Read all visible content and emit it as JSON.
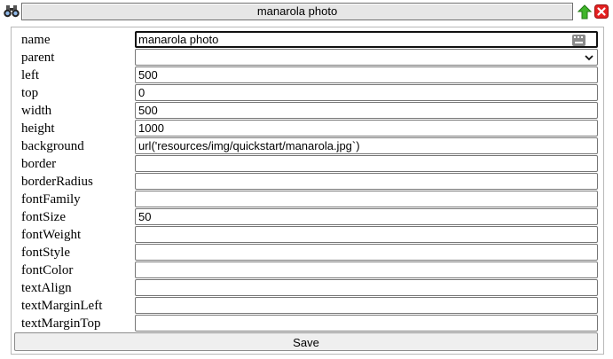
{
  "window": {
    "title": "manarola photo"
  },
  "icons": {
    "binoculars": "binoculars-icon",
    "up": "green-up-arrow-icon",
    "close": "red-close-icon",
    "keyboard": "keyboard-icon",
    "chevron": "chevron-down-icon"
  },
  "colors": {
    "up_green": "#3fb52a",
    "close_red": "#e32121"
  },
  "form": {
    "fields": [
      {
        "label": "name",
        "value": "manarola photo"
      },
      {
        "label": "parent",
        "value": ""
      },
      {
        "label": "left",
        "value": "500"
      },
      {
        "label": "top",
        "value": "0"
      },
      {
        "label": "width",
        "value": "500"
      },
      {
        "label": "height",
        "value": "1000"
      },
      {
        "label": "background",
        "value": "url('resources/img/quickstart/manarola.jpg`)"
      },
      {
        "label": "border",
        "value": ""
      },
      {
        "label": "borderRadius",
        "value": ""
      },
      {
        "label": "fontFamily",
        "value": ""
      },
      {
        "label": "fontSize",
        "value": "50"
      },
      {
        "label": "fontWeight",
        "value": ""
      },
      {
        "label": "fontStyle",
        "value": ""
      },
      {
        "label": "fontColor",
        "value": ""
      },
      {
        "label": "textAlign",
        "value": ""
      },
      {
        "label": "textMarginLeft",
        "value": ""
      },
      {
        "label": "textMarginTop",
        "value": ""
      }
    ],
    "save_label": "Save"
  }
}
